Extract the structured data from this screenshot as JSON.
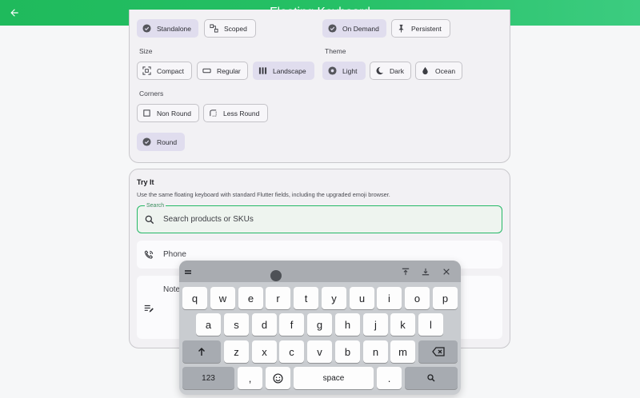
{
  "appbar": {
    "title": "Floating Keyboard"
  },
  "mode_chips": {
    "standalone": "Standalone",
    "scoped": "Scoped",
    "on_demand": "On Demand",
    "persistent": "Persistent"
  },
  "size": {
    "label": "Size",
    "compact": "Compact",
    "regular": "Regular",
    "landscape": "Landscape",
    "selected": "Landscape"
  },
  "theme": {
    "label": "Theme",
    "light": "Light",
    "dark": "Dark",
    "ocean": "Ocean",
    "selected": "Light"
  },
  "corners": {
    "label": "Corners",
    "non_round": "Non Round",
    "less_round": "Less Round",
    "round": "Round",
    "selected": "Round"
  },
  "try_it": {
    "title": "Try It",
    "description": "Use the same floating keyboard with standard Flutter fields, including the upgraded emoji browser.",
    "search_label": "Search",
    "search_placeholder": "Search products or SKUs",
    "phone_label": "Phone",
    "notes_label": "Notes"
  },
  "keyboard": {
    "row1": [
      "q",
      "w",
      "e",
      "r",
      "t",
      "y",
      "u",
      "i",
      "o",
      "p"
    ],
    "row2": [
      "a",
      "s",
      "d",
      "f",
      "g",
      "h",
      "j",
      "k",
      "l"
    ],
    "row3": [
      "z",
      "x",
      "c",
      "v",
      "b",
      "n",
      "m"
    ],
    "numbers_key": "123",
    "comma_key": ",",
    "space_key": "space",
    "period_key": "."
  },
  "colors": {
    "accent": "#25b866",
    "selected_chip": "#e0ddee",
    "keyboard_bg": "#c9ccd0"
  }
}
